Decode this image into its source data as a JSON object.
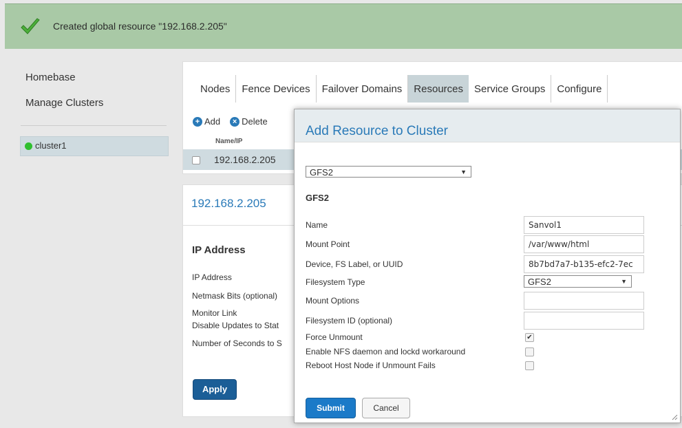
{
  "notification": {
    "message": "Created global resource \"192.168.2.205\"",
    "icon": "checkmark-icon",
    "color": "#a9c9a6"
  },
  "nav": {
    "homebase": "Homebase",
    "manage_clusters": "Manage Clusters",
    "cluster_name": "cluster1"
  },
  "tabs": [
    "Nodes",
    "Fence Devices",
    "Failover Domains",
    "Resources",
    "Service Groups",
    "Configure"
  ],
  "active_tab": "Resources",
  "toolbar": {
    "add": "Add",
    "delete": "Delete"
  },
  "table": {
    "column": "Name/IP",
    "row": "192.168.2.205"
  },
  "detail": {
    "title": "192.168.2.205",
    "heading": "IP Address",
    "fields": [
      "IP Address",
      "Netmask Bits (optional)",
      "Monitor Link",
      "Disable Updates to Stat",
      "Number of Seconds to S"
    ],
    "apply": "Apply"
  },
  "modal": {
    "title": "Add Resource to Cluster",
    "resource_type": "GFS2",
    "subtitle": "GFS2",
    "fields": {
      "name": {
        "label": "Name",
        "value": "Sanvol1"
      },
      "mount_point": {
        "label": "Mount Point",
        "value": "/var/www/html"
      },
      "device": {
        "label": "Device, FS Label, or UUID",
        "value": "8b7bd7a7-b135-efc2-7ec"
      },
      "fs_type": {
        "label": "Filesystem Type",
        "value": "GFS2"
      },
      "mount_options": {
        "label": "Mount Options",
        "value": ""
      },
      "fs_id": {
        "label": "Filesystem ID (optional)",
        "value": ""
      },
      "force_unmount": {
        "label": "Force Unmount",
        "checked": true
      },
      "nfs_workaround": {
        "label": "Enable NFS daemon and lockd workaround",
        "checked": false
      },
      "reboot": {
        "label": "Reboot Host Node if Unmount Fails",
        "checked": false
      }
    },
    "submit": "Submit",
    "cancel": "Cancel"
  },
  "colors": {
    "accent": "#2a7ab8",
    "primary_button": "#1b7ac8",
    "selected_row": "#cfdbe0",
    "status_online": "#2fbf2f"
  }
}
